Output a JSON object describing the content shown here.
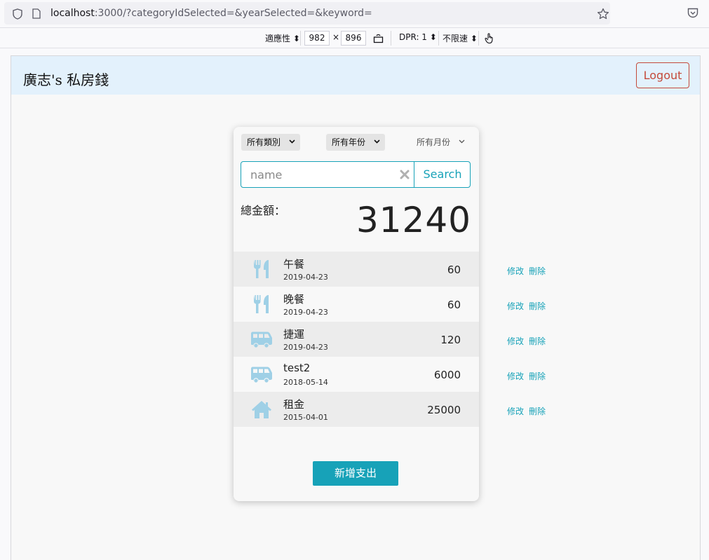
{
  "browser": {
    "url_host": "localhost",
    "url_rest": ":3000/?categoryIdSelected=&yearSelected=&keyword=",
    "rdm": {
      "preset": "適應性",
      "width": "982",
      "times": "×",
      "height": "896",
      "dpr": "DPR: 1",
      "throttle": "不限速"
    }
  },
  "header": {
    "brand": "廣志's 私房錢",
    "logout": "Logout"
  },
  "filters": {
    "category": "所有類別",
    "year": "所有年份",
    "month": "所有月份"
  },
  "search": {
    "placeholder": "name",
    "button": "Search"
  },
  "total": {
    "label": "總金額：",
    "value": "31240"
  },
  "records": [
    {
      "icon": "utensils-icon",
      "name": "午餐",
      "date": "2019-04-23",
      "amount": "60"
    },
    {
      "icon": "utensils-icon",
      "name": "晚餐",
      "date": "2019-04-23",
      "amount": "60"
    },
    {
      "icon": "shuttle-van-icon",
      "name": "捷運",
      "date": "2019-04-23",
      "amount": "120"
    },
    {
      "icon": "shuttle-van-icon",
      "name": "test2",
      "date": "2018-05-14",
      "amount": "6000"
    },
    {
      "icon": "home-icon",
      "name": "租金",
      "date": "2015-04-01",
      "amount": "25000"
    }
  ],
  "actions": {
    "edit": "修改",
    "delete": "刪除"
  },
  "add_button": "新增支出",
  "colors": {
    "accent": "#17a2b8",
    "icon": "#9fd0e6",
    "danger": "#c44a3a",
    "header_bg": "#e3f1fc"
  }
}
